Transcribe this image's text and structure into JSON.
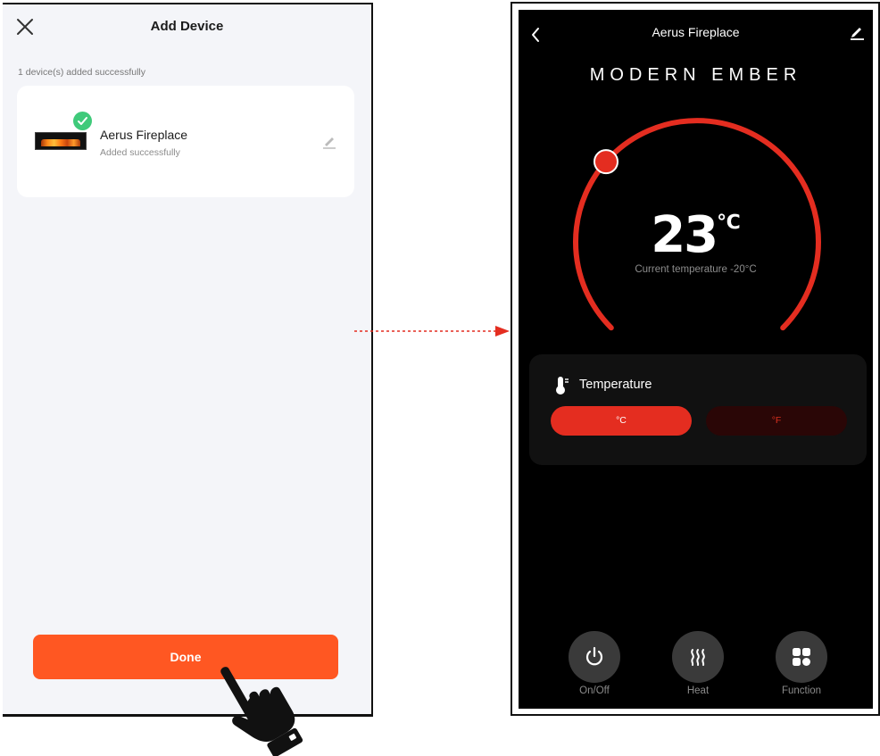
{
  "add_device": {
    "title": "Add Device",
    "status": "1 device(s) added successfully",
    "device": {
      "name": "Aerus Fireplace",
      "sub": "Added successfully"
    },
    "done_label": "Done"
  },
  "control": {
    "title": "Aerus Fireplace",
    "brand": "MODERN EMBER",
    "set_temp": "23",
    "set_unit": "℃",
    "current_temp": "Current temperature -20°C",
    "set_temp_level": 0.32,
    "panel_label": "Temperature",
    "unit_c": "°C",
    "unit_f": "°F",
    "buttons": [
      {
        "label": "On/Off",
        "icon": "power-icon"
      },
      {
        "label": "Heat",
        "icon": "heat-waves-icon"
      },
      {
        "label": "Function",
        "icon": "grid-icon"
      }
    ]
  },
  "colors": {
    "done_button": "#ff5722",
    "accent_red": "#e42d20",
    "success_green": "#3fca7a",
    "control_bg": "#000000"
  }
}
